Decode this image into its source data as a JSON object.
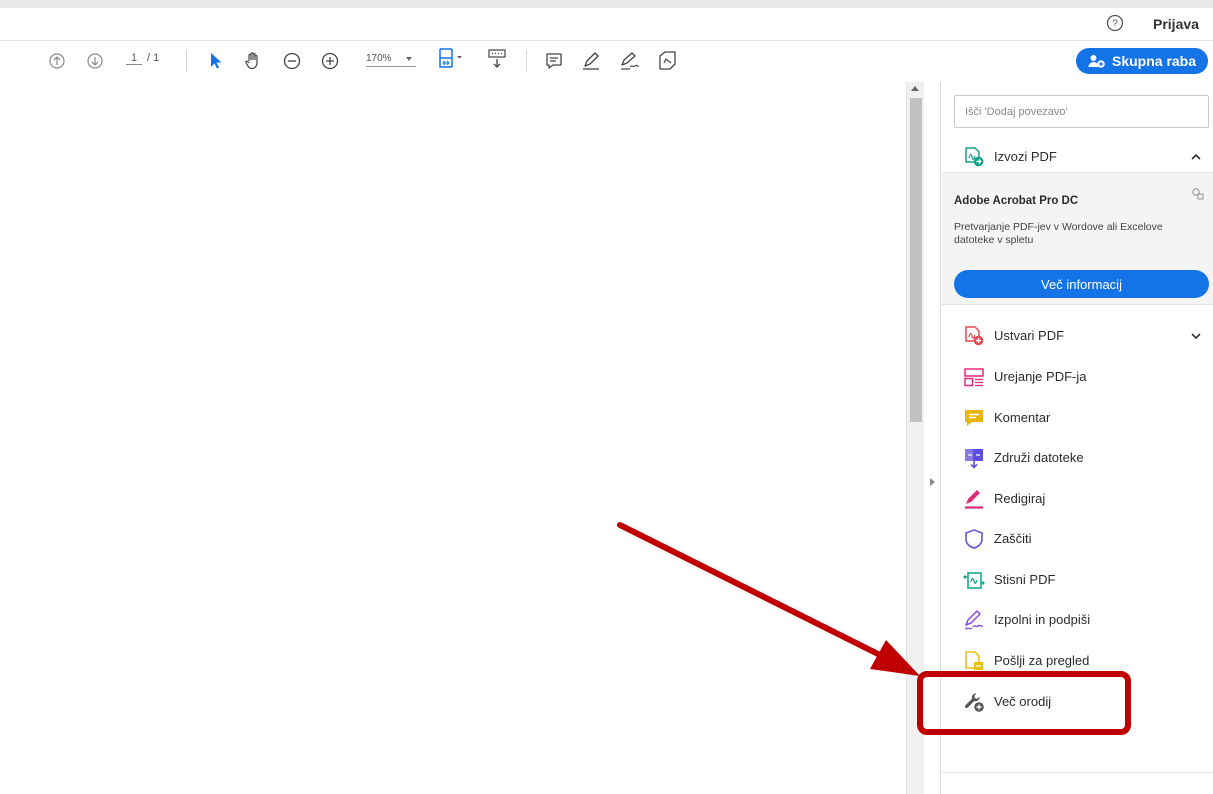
{
  "topbar": {
    "signin_label": "Prijava"
  },
  "toolbar": {
    "page_current": "1",
    "page_total": "/ 1",
    "zoom": "170%",
    "share_label": "Skupna raba"
  },
  "panel": {
    "search_placeholder": "Išči 'Dodaj povezavo'",
    "export_label": "Izvozi PDF",
    "promo": {
      "title": "Adobe Acrobat Pro DC",
      "description": "Pretvarjanje PDF-jev v Wordove ali Excelove datoteke v spletu",
      "button": "Več informacij"
    },
    "tools": [
      {
        "label": "Ustvari PDF",
        "icon": "create-pdf-icon",
        "color": "#e34850"
      },
      {
        "label": "Urejanje PDF-ja",
        "icon": "edit-pdf-icon",
        "color": "#e6297b"
      },
      {
        "label": "Komentar",
        "icon": "comment-icon",
        "color": "#e8b50b"
      },
      {
        "label": "Združi datoteke",
        "icon": "combine-files-icon",
        "color": "#5e4fe0"
      },
      {
        "label": "Redigiraj",
        "icon": "redact-icon",
        "color": "#d92c7a"
      },
      {
        "label": "Zaščiti",
        "icon": "protect-icon",
        "color": "#6b5fd6"
      },
      {
        "label": "Stisni PDF",
        "icon": "compress-pdf-icon",
        "color": "#0fa08a"
      },
      {
        "label": "Izpolni in podpiši",
        "icon": "fill-sign-icon",
        "color": "#8e4ad8"
      },
      {
        "label": "Pošlji za pregled",
        "icon": "send-review-icon",
        "color": "#eac00f"
      },
      {
        "label": "Več orodij",
        "icon": "more-tools-icon",
        "color": "#555555"
      }
    ]
  },
  "colors": {
    "accent": "#1473e6",
    "annotation": "#c00000"
  }
}
